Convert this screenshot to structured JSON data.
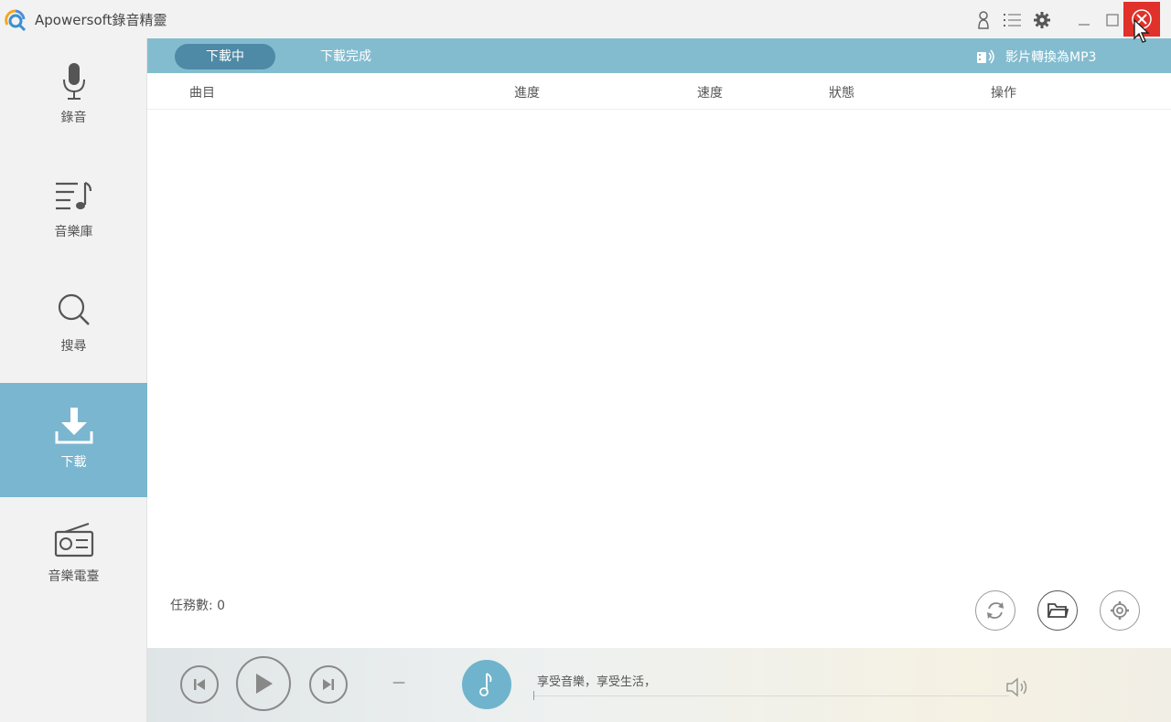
{
  "window": {
    "title": "Apowersoft錄音精靈",
    "controls": [
      "user-icon",
      "list-icon",
      "gear-icon",
      "minimize-icon",
      "maximize-icon",
      "close-icon"
    ],
    "close_color": "#e0312a"
  },
  "sidebar": {
    "items": [
      {
        "label": "錄音",
        "icon": "microphone-icon",
        "active": false
      },
      {
        "label": "音樂庫",
        "icon": "music-library-icon",
        "active": false
      },
      {
        "label": "搜尋",
        "icon": "search-icon",
        "active": false
      },
      {
        "label": "下載",
        "icon": "download-icon",
        "active": true
      },
      {
        "label": "音樂電臺",
        "icon": "radio-icon",
        "active": false
      }
    ],
    "active_color": "#7ab6cf"
  },
  "main": {
    "tabs": [
      {
        "label": "下載中",
        "active": true
      },
      {
        "label": "下載完成",
        "active": false
      }
    ],
    "convert_label": "影片轉換為MP3",
    "columns": [
      "曲目",
      "進度",
      "速度",
      "狀態",
      "操作"
    ],
    "task_count": "任務數: 0",
    "actions": [
      "refresh-icon",
      "folder-icon",
      "settings-icon"
    ],
    "tabbar_color": "#83bccf"
  },
  "player": {
    "time_separator": "—",
    "slogan": "享受音樂，享受生活，",
    "accent": "#6fb4cc"
  }
}
